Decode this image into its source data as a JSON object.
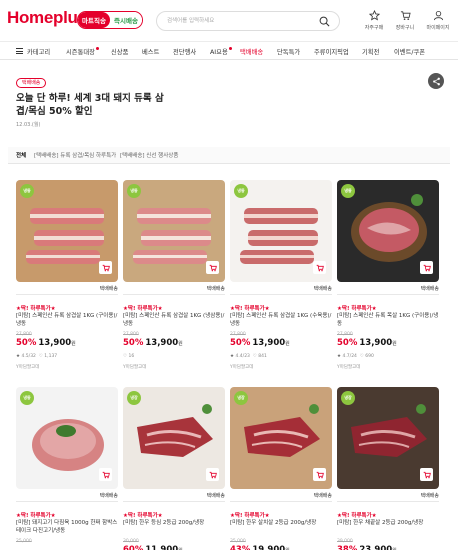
{
  "header": {
    "logo": "Homeplus",
    "tabs": [
      {
        "label": "마트직송",
        "active": true
      },
      {
        "label": "즉시배송",
        "active": false
      }
    ],
    "search_placeholder": "검색어를 입력하세요",
    "utils": [
      {
        "label": "자주구매",
        "icon": "star-icon"
      },
      {
        "label": "장바구니",
        "icon": "cart-icon"
      },
      {
        "label": "마이페이지",
        "icon": "person-icon"
      }
    ]
  },
  "nav": {
    "category": "카테고리",
    "items": [
      "시즌통대장",
      "신상품",
      "베스트",
      "전단행사",
      "AI요용",
      "택배배송",
      "단독특가",
      "주류이지픽업",
      "기획전",
      "이벤트/쿠폰"
    ]
  },
  "event": {
    "badge": "택배배송",
    "title": "오늘 단 하루! 세계 3대 돼지 듀록 삼겹/목심 50% 할인",
    "date": "12.03.(월)"
  },
  "subtabs": [
    "전체",
    "[택배배송] 듀록 삼겹/목심 하루특가",
    "[택배배송] 신선 행사상품"
  ],
  "products": [
    {
      "badge": "냉동",
      "delivery": "택배배송",
      "promo": "★딱! 하루특가★",
      "name": "[미탐] 스페인산 듀록 삼겹살 1KG (구이용)/냉동",
      "original": "27,800",
      "rate": "50%",
      "price": "13,900",
      "won": "원",
      "rating": "4.5",
      "reviews": "32",
      "likes": "1,137",
      "seller": "Y마담팔고데"
    },
    {
      "badge": "냉동",
      "delivery": "택배배송",
      "promo": "★딱! 하루특가★",
      "name": "[미탐] 스페인산 듀록 삼겹살 1KG (냉삼용)/냉동",
      "original": "27,800",
      "rate": "50%",
      "price": "13,900",
      "won": "원",
      "rating": "",
      "reviews": "",
      "likes": "16",
      "seller": "Y마담팔고데"
    },
    {
      "badge": "냉동",
      "delivery": "택배배송",
      "promo": "★딱! 하루특가★",
      "name": "[미탐] 스페인산 듀록 삼겹살 1KG (수육용)/냉동",
      "original": "27,800",
      "rate": "50%",
      "price": "13,900",
      "won": "원",
      "rating": "4.4",
      "reviews": "23",
      "likes": "841",
      "seller": "Y마담팔고데"
    },
    {
      "badge": "냉동",
      "delivery": "택배배송",
      "promo": "★딱! 하루특가★",
      "name": "[미탐] 스페인산 듀록 목살 1KG (구이용)/냉동",
      "original": "27,800",
      "rate": "50%",
      "price": "13,900",
      "won": "원",
      "rating": "4.7",
      "reviews": "24",
      "likes": "690",
      "seller": "Y마담팔고데"
    },
    {
      "badge": "냉동",
      "delivery": "택배배송",
      "promo": "★딱! 하루특가★",
      "name": "[미탐] 돼지고기 다짐육 1000g 한쩌 함박스테이크 다진고기/냉동",
      "original": "25,000",
      "rate": "",
      "price": "",
      "won": "",
      "rating": "",
      "reviews": "",
      "likes": "",
      "seller": ""
    },
    {
      "badge": "냉장",
      "delivery": "택배배송",
      "promo": "★딱! 하루특가★",
      "name": "[미탐] 한우 등심 2등급 200g/냉장",
      "original": "30,000",
      "rate": "60%",
      "price": "11,900",
      "won": "원",
      "rating": "",
      "reviews": "",
      "likes": "",
      "seller": ""
    },
    {
      "badge": "냉장",
      "delivery": "택배배송",
      "promo": "★딱! 하루특가★",
      "name": "[미탐] 한우 살치살 2등급 200g/냉장",
      "original": "35,000",
      "rate": "43%",
      "price": "19,900",
      "won": "원",
      "rating": "",
      "reviews": "",
      "likes": "",
      "seller": ""
    },
    {
      "badge": "냉장",
      "delivery": "택배배송",
      "promo": "★딱! 하루특가★",
      "name": "[미탐] 한우 채끝살 2등급 200g/냉장",
      "original": "39,000",
      "rate": "38%",
      "price": "23,900",
      "won": "원",
      "rating": "",
      "reviews": "",
      "likes": "",
      "seller": ""
    }
  ],
  "colors": {
    "brand": "#e4002b",
    "secondary": "#2a9b4a",
    "ship_badge": "#8dc63f"
  }
}
